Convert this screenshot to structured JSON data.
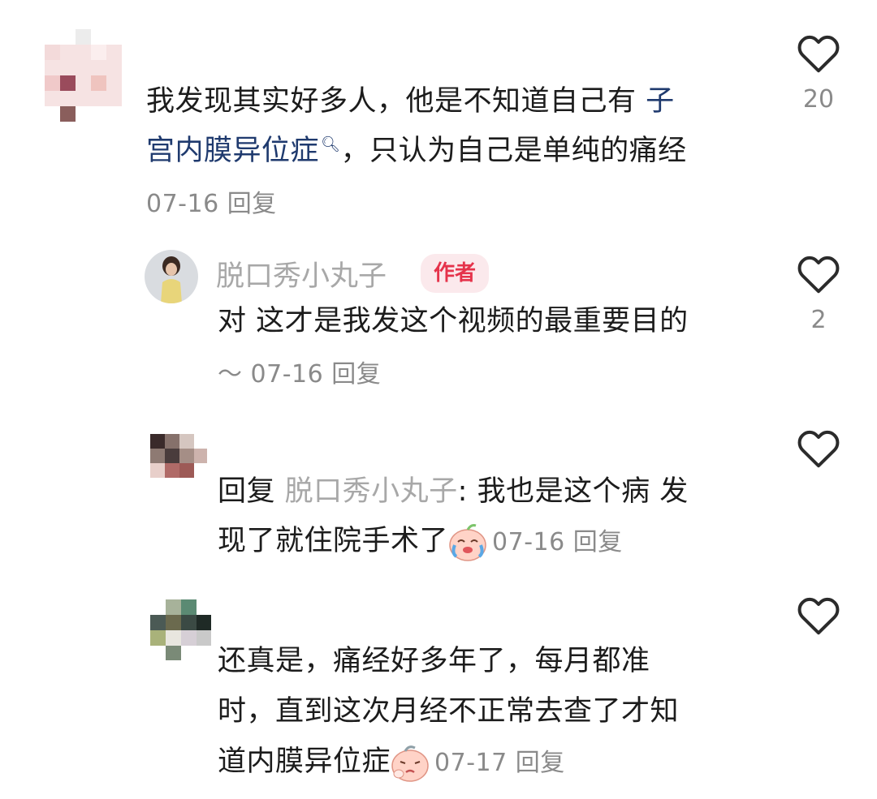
{
  "comments": [
    {
      "text_line1_pre": "我发现其实好多人，他是不知道自己有",
      "text_line1_link": "子",
      "text_line2_link": "宫内膜异位症",
      "text_line2_post": "，只认为自己是单纯的痛经",
      "date": "07-16",
      "reply_label": "回复",
      "likes": "20"
    },
    {
      "username": "脱口秀小丸子",
      "badge": "作者",
      "text_line1": "对 这才是我发这个视频的最重要目的",
      "text_line2_prefix": "～",
      "date": "07-16",
      "reply_label": "回复",
      "likes": "2"
    },
    {
      "reply_prefix": "回复",
      "reply_to": "脱口秀小丸子",
      "colon": ":",
      "text_line1": "我也是这个病 发",
      "text_line2": "现了就住院手术了",
      "emoji": "crying-laughing-face-icon",
      "date": "07-16",
      "reply_label": "回复"
    },
    {
      "text_line1": "还真是，痛经好多年了，每月都准",
      "text_line2": "时，直到这次月经不正常去查了才知",
      "text_line3": "道内膜异位症",
      "emoji": "sad-face-icon",
      "date": "07-17",
      "reply_label": "回复"
    }
  ],
  "colors": {
    "link": "#1f3a6e",
    "meta": "#8a8a8a",
    "badge_bg": "#fbe9ec",
    "badge_fg": "#e5334b"
  }
}
